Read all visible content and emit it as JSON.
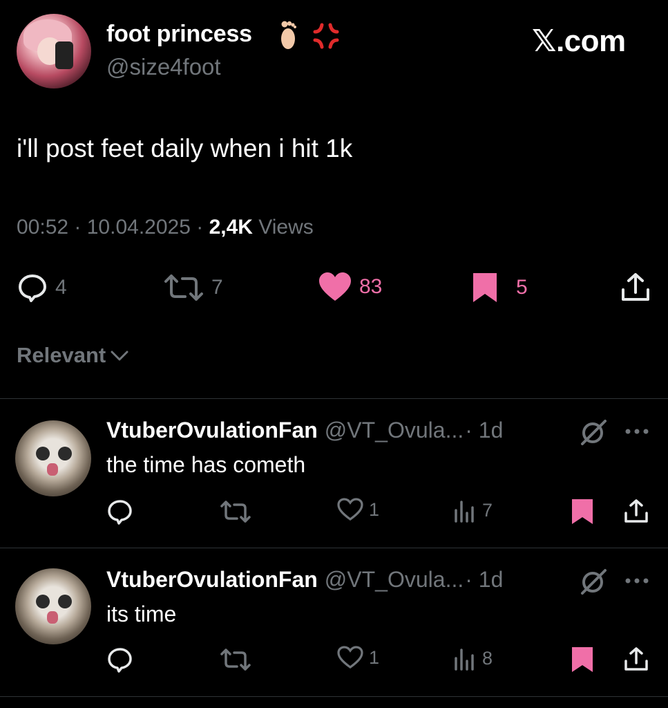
{
  "header": {
    "display_name": "foot princess",
    "handle": "@size4foot",
    "brand": "𝕏.com",
    "emojis": [
      "foot-emoji",
      "anger-emoji"
    ]
  },
  "tweet": {
    "text": "i'll post feet daily when i hit 1k",
    "time": "00:52",
    "date": "10.04.2025",
    "views_count": "2,4K",
    "views_label": "Views",
    "replies": "4",
    "reposts": "7",
    "likes": "83",
    "bookmarks": "5"
  },
  "sort": {
    "label": "Relevant"
  },
  "replies": [
    {
      "name": "VtuberOvulationFan",
      "handle": "@VT_Ovula...",
      "time": "· 1d",
      "text": "the time has cometh",
      "likes": "1",
      "views": "7"
    },
    {
      "name": "VtuberOvulationFan",
      "handle": "@VT_Ovula...",
      "time": "· 1d",
      "text": "its time",
      "likes": "1",
      "views": "8"
    }
  ],
  "colors": {
    "background": "#000000",
    "text": "#e7e9ea",
    "muted": "#71767b",
    "accent_pink": "#f06fa8",
    "divider": "#2f3336"
  }
}
